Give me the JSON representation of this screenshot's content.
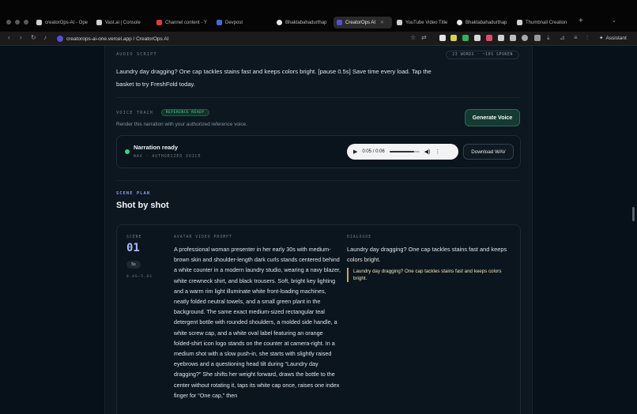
{
  "browser": {
    "tabs": [
      {
        "label": "creatorOps-AI - Ope",
        "color": "#cfcfcf",
        "active": false
      },
      {
        "label": "Vast.ai | Console",
        "color": "#cfcfcf",
        "active": false
      },
      {
        "label": "Channel content - Y",
        "color": "#e53935",
        "active": false
      },
      {
        "label": "Devpost",
        "color": "#3f6be0",
        "active": false
      },
      {
        "label": "Bhaktabahadurthap",
        "color": "#e8e8e8",
        "active": false
      },
      {
        "label": "CreatorOps AI",
        "color": "#5a4cd8",
        "active": true
      },
      {
        "label": "YouTube Video Title",
        "color": "#cfcfcf",
        "active": false
      },
      {
        "label": "Bhaktabahadurthap",
        "color": "#e8e8e8",
        "active": false
      },
      {
        "label": "Thumbnail Creation",
        "color": "#cfcfcf",
        "active": false
      }
    ],
    "new_tab": "+",
    "url": "creatorops-ai-one.vercel.app / CreatorOps AI",
    "assistant_label": "Assistant"
  },
  "audio_script": {
    "label": "AUDIO SCRIPT",
    "word_chip": "23 WORDS · ~10S SPOKEN",
    "text": "Laundry day dragging? One cap tackles stains fast and keeps colors bright. [pause 0.5s] Save time every load. Tap the basket to try FreshFold today."
  },
  "voice_track": {
    "label": "VOICE TRACK",
    "badge": "REFERENCE READY",
    "description": "Render this narration with your authorized reference voice.",
    "generate_button": "Generate Voice",
    "status_title": "Narration ready",
    "status_meta": "WAV · AUTHORIZED VOICE",
    "player_time": "0:05 / 0:06",
    "progress": 0.83,
    "download_button": "Download WAV"
  },
  "scene_plan": {
    "label": "SCENE PLAN",
    "title": "Shot by shot",
    "scene": {
      "label": "SCENE",
      "number": "01",
      "duration": "5s",
      "range": "0.0S–5.0S",
      "prompt_label": "AVATAR VIDEO PROMPT",
      "prompt": "A professional woman presenter in her early 30s with medium-brown skin and shoulder-length dark curls stands centered behind a white counter in a modern laundry studio, wearing a navy blazer, white crewneck shirt, and black trousers. Soft, bright key lighting and a warm rim light illuminate white front-loading machines, neatly folded neutral towels, and a small green plant in the background. The same exact medium-sized rectangular teal detergent bottle with rounded shoulders, a molded side handle, a white screw cap, and a white oval label featuring an orange folded-shirt icon logo stands on the counter at camera-right. In a medium shot with a slow push-in, she starts with slightly raised eyebrows and a questioning head tilt during “Laundry day dragging?” She shifts her weight forward, draws the bottle to the center without rotating it, taps its white cap once, raises one index finger for “One cap,” then",
      "dialogue_label": "DIALOGUE",
      "dialogue": "Laundry day dragging? One cap tackles stains fast and keeps colors bright.",
      "quote": "Laundry day dragging? One cap tackles stains fast and keeps colors bright."
    }
  }
}
